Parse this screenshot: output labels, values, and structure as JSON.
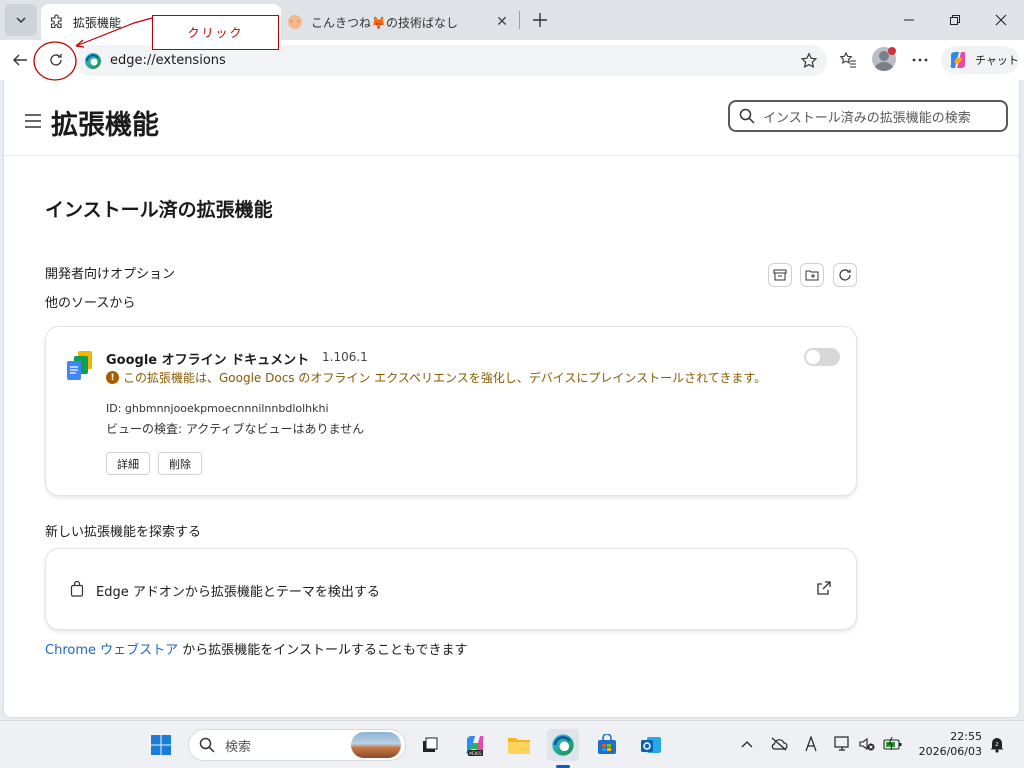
{
  "browser": {
    "tabs": [
      {
        "title": "拡張機能",
        "active": true
      },
      {
        "title": "こんきつね🦊の技術ばなし",
        "active": false
      }
    ],
    "address": "edge://extensions",
    "copilot_label": "チャット"
  },
  "annotation": {
    "label": "クリック"
  },
  "page": {
    "title": "拡張機能",
    "search_placeholder": "インストール済みの拡張機能の検索",
    "section_title": "インストール済の拡張機能",
    "dev_options": "開発者向けオプション",
    "from_other_sources": "他のソースから",
    "extension": {
      "name": "Google オフライン ドキュメント",
      "version": "1.106.1",
      "warning": "この拡張機能は、Google Docs のオフライン エクスペリエンスを強化し、デバイスにプレインストールされてきます。",
      "id": "ID: ghbmnnjooekpmoecnnnilnnbdlolhkhi",
      "inspect_views": "ビューの検査: アクティブなビューはありません",
      "details_label": "詳細",
      "remove_label": "削除",
      "enabled": false
    },
    "discover_title": "新しい拡張機能を探索する",
    "addon_link": "Edge アドオンから拡張機能とテーマを検出する",
    "chrome_store": {
      "prefix": "Chrome",
      "link": "ウェブストア",
      "suffix": "から拡張機能をインストールすることもできます"
    }
  },
  "taskbar": {
    "search_placeholder": "検索",
    "time": "22:55",
    "date": "2026/06/03"
  },
  "colors": {
    "accent": "#0a5fc4",
    "annotation": "#c00000",
    "warning": "#8a5a00"
  }
}
